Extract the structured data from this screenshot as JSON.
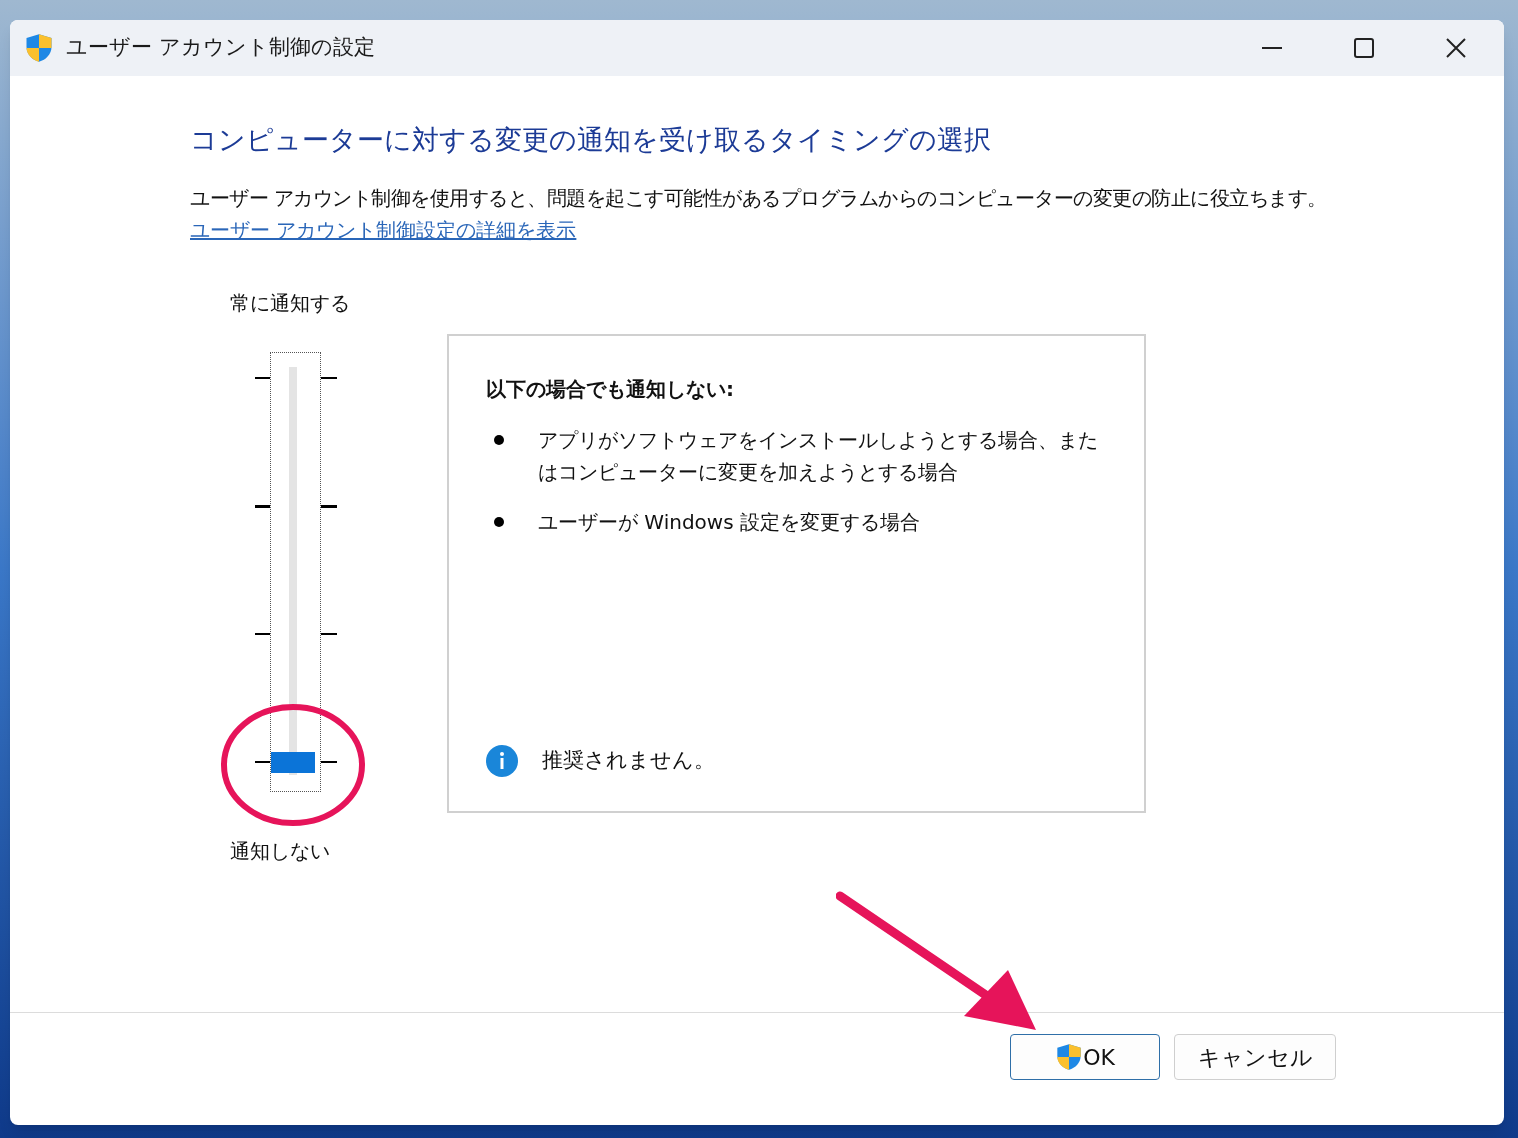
{
  "window": {
    "title": "ユーザー アカウント制御の設定"
  },
  "heading": "コンピューターに対する変更の通知を受け取るタイミングの選択",
  "description": "ユーザー アカウント制御を使用すると、問題を起こす可能性があるプログラムからのコンピューターの変更の防止に役立ちます。",
  "link": "ユーザー アカウント制御設定の詳細を表示",
  "slider": {
    "top_label": "常に通知する",
    "bottom_label": "通知しない",
    "level": 0
  },
  "panel": {
    "title": "以下の場合でも通知しない:",
    "bullets": [
      "アプリがソフトウェアをインストールしようとする場合、またはコンピューターに変更を加えようとする場合",
      "ユーザーが Windows 設定を変更する場合"
    ],
    "note": "推奨されません。"
  },
  "buttons": [
    {
      "label": "OK",
      "kind": "shield",
      "default": true
    },
    {
      "label": "キャンセル",
      "kind": "plain",
      "default": false
    }
  ]
}
